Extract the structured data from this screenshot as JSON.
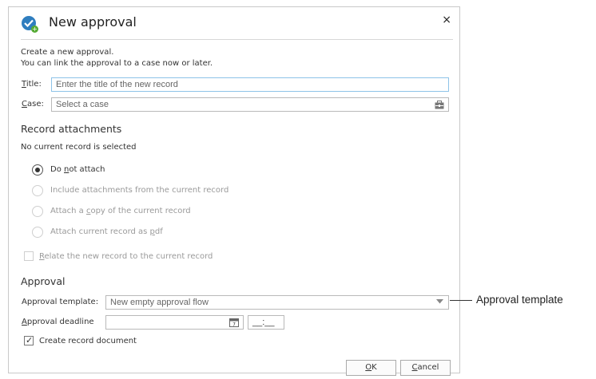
{
  "dialog": {
    "title": "New approval",
    "close_label": "×",
    "intro_line1": "Create a new approval.",
    "intro_line2": "You can link the approval to a case now or later."
  },
  "fields": {
    "title_label_first": "T",
    "title_label_rest": "itle:",
    "title_placeholder": "Enter the title of the new record",
    "case_label_first": "C",
    "case_label_rest": "ase:",
    "case_placeholder": "Select a case"
  },
  "attachments": {
    "section_title": "Record attachments",
    "status": "No current record is selected",
    "options": [
      {
        "pre": "Do ",
        "ul": "n",
        "post": "ot attach",
        "checked": true,
        "enabled": true
      },
      {
        "pre": "Include attachments from the current record",
        "ul": "",
        "post": "",
        "checked": false,
        "enabled": false
      },
      {
        "pre": "Attach a ",
        "ul": "c",
        "post": "opy of the current record",
        "checked": false,
        "enabled": false
      },
      {
        "pre": "Attach current record as ",
        "ul": "p",
        "post": "df",
        "checked": false,
        "enabled": false
      }
    ],
    "relate_ul": "R",
    "relate_rest": "elate the new record to the current record"
  },
  "approval": {
    "section_title": "Approval",
    "template_label": "Approval template:",
    "template_value": "New empty approval flow",
    "deadline_label_first": "A",
    "deadline_label_rest": "pproval deadline",
    "time_value": "__:__",
    "create_doc_label": "Create record document",
    "create_doc_checked": true
  },
  "buttons": {
    "ok_ul": "O",
    "ok_rest": "K",
    "cancel_ul": "C",
    "cancel_rest": "ancel"
  },
  "callout": {
    "text": "Approval template"
  },
  "colors": {
    "accent_border": "#8ec3e8",
    "app_icon": "#2f7ebf",
    "plus_badge": "#55aa33"
  }
}
